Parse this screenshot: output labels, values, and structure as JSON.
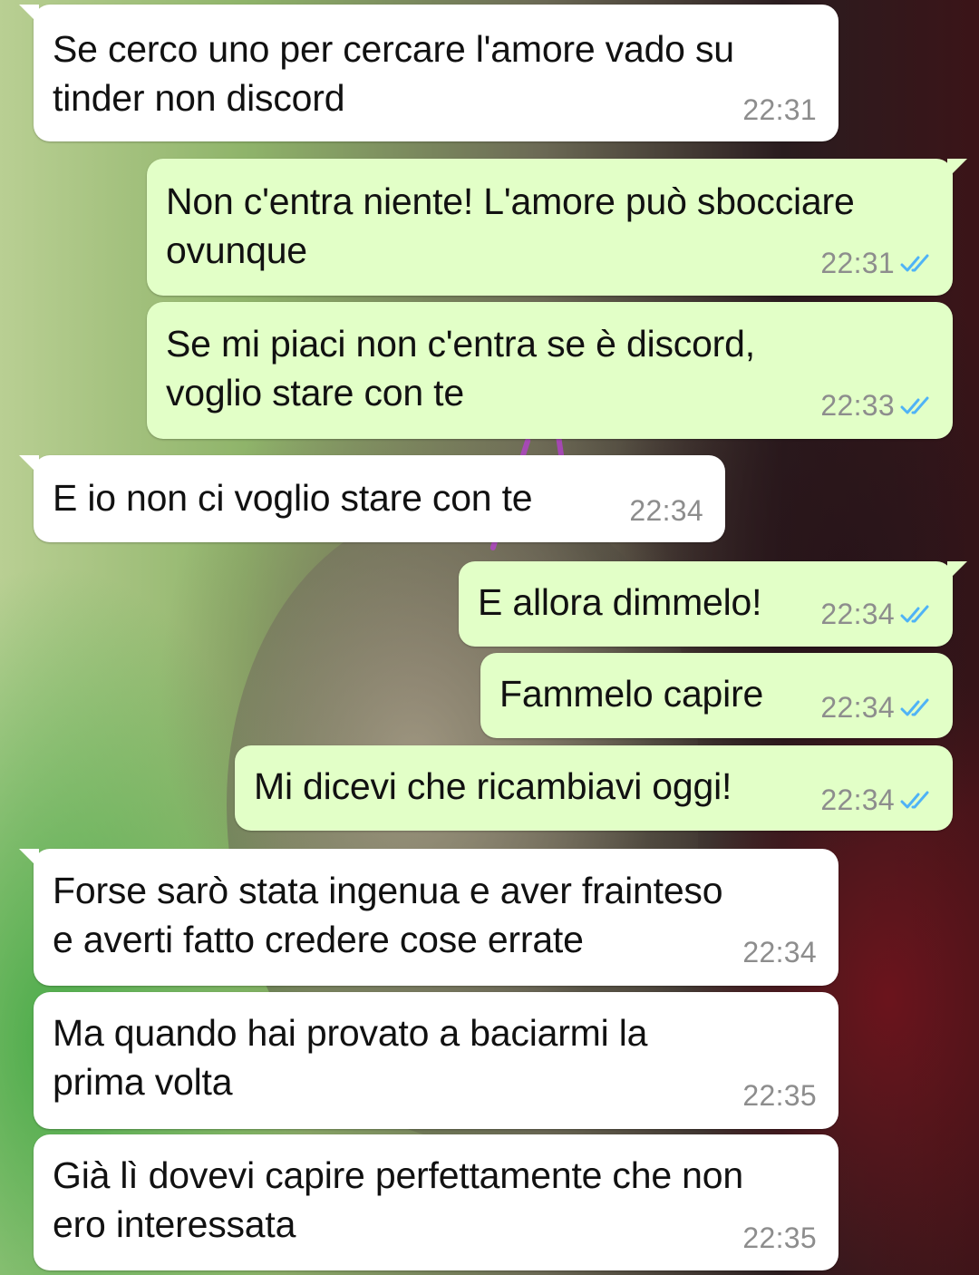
{
  "theme": {
    "incoming_bubble": "#ffffff",
    "outgoing_bubble": "#e2ffc7",
    "timestamp_color": "#8d8d8d",
    "read_tick_color": "#4fb3f6"
  },
  "messages": [
    {
      "direction": "incoming",
      "text": "Se cerco uno per cercare l'amore vado su\ntinder non discord",
      "time": "22:31"
    },
    {
      "direction": "outgoing",
      "text": "Non c'entra niente! L'amore può sbocciare\novunque",
      "time": "22:31",
      "status_icon": "double-check-read-icon"
    },
    {
      "direction": "outgoing",
      "text": "Se mi piaci non c'entra se è discord,\nvoglio stare con te",
      "time": "22:33",
      "status_icon": "double-check-read-icon"
    },
    {
      "direction": "incoming",
      "text": "E io non ci voglio stare con te",
      "time": "22:34"
    },
    {
      "direction": "outgoing",
      "text": "E allora dimmelo!",
      "time": "22:34",
      "status_icon": "double-check-read-icon"
    },
    {
      "direction": "outgoing",
      "text": "Fammelo capire",
      "time": "22:34",
      "status_icon": "double-check-read-icon"
    },
    {
      "direction": "outgoing",
      "text": "Mi dicevi che ricambiavi oggi!",
      "time": "22:34",
      "status_icon": "double-check-read-icon"
    },
    {
      "direction": "incoming",
      "text": "Forse sarò stata ingenua e aver frainteso\ne averti fatto credere cose errate",
      "time": "22:34"
    },
    {
      "direction": "incoming",
      "text": "Ma quando hai provato a baciarmi la\nprima volta",
      "time": "22:35"
    },
    {
      "direction": "incoming",
      "text": "Già lì dovevi capire perfettamente che non\nero interessata",
      "time": "22:35"
    }
  ]
}
